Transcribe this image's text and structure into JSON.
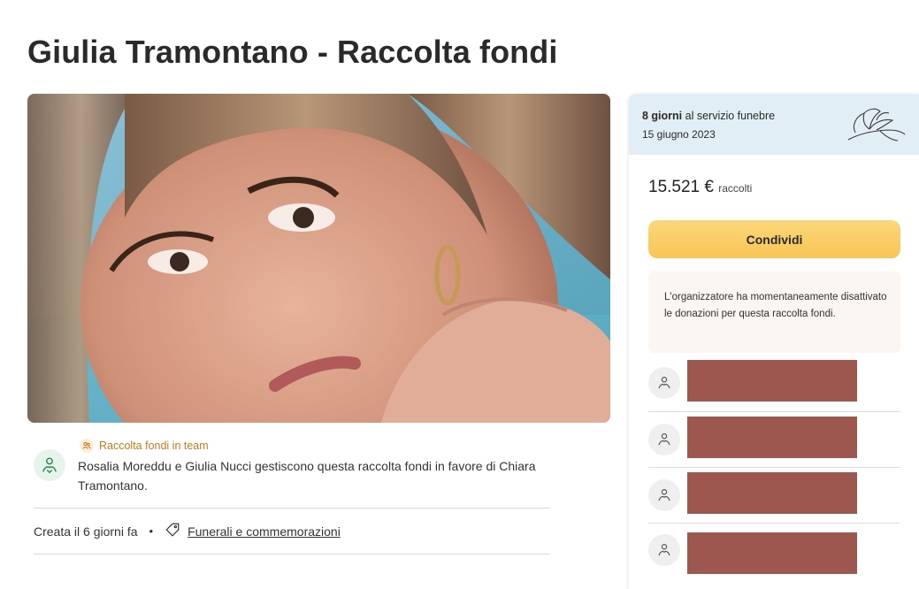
{
  "page": {
    "title": "Giulia Tramontano - Raccolta fondi"
  },
  "team": {
    "badge": "Raccolta fondi in team",
    "description": "Rosalia Moreddu e Giulia Nucci gestiscono questa raccolta fondi in favore di Chiara Tramontano."
  },
  "meta": {
    "created": "Creata il 6 giorni fa",
    "bullet": "•",
    "category": "Funerali e commemorazioni"
  },
  "funeral": {
    "days_bold": "8 giorni",
    "days_rest": " al servizio funebre",
    "date": "15 giugno 2023"
  },
  "fundraiser": {
    "amount": "15.521 €",
    "amount_suffix": "raccolti",
    "share_label": "Condividi",
    "notice": "L'organizzatore ha momentaneamente disattivato le donazioni per questa raccolta fondi."
  },
  "colors": {
    "share_button": "#f8c555",
    "redaction": "#9d574f",
    "funeral_banner": "#e2eef5",
    "team_badge": "#c47a18"
  },
  "icons": {
    "team_avatar": "heart-hand-icon",
    "team_badge": "people-icon",
    "category": "tag-icon",
    "funeral": "lily-flower-icon",
    "donor": "heart-hand-icon"
  }
}
